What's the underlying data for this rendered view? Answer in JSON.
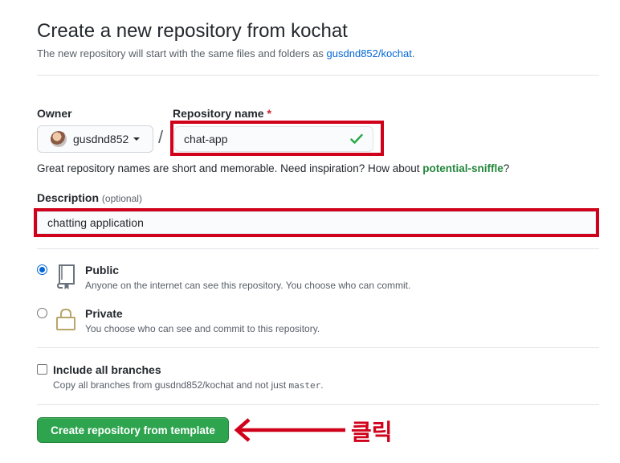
{
  "header": {
    "title": "Create a new repository from kochat",
    "subtitle_prefix": "The new repository will start with the same files and folders as ",
    "subtitle_link": "gusdnd852/kochat",
    "subtitle_suffix": "."
  },
  "form": {
    "owner_label": "Owner",
    "owner_value": "gusdnd852",
    "repo_name_label": "Repository name",
    "required_mark": "*",
    "repo_name_value": "chat-app",
    "separator": "/",
    "hint_prefix": "Great repository names are short and memorable. Need inspiration? How about ",
    "hint_suggestion": "potential-sniffle",
    "hint_suffix": "?",
    "description_label": "Description",
    "description_optional": "(optional)",
    "description_value": "chatting application"
  },
  "visibility": {
    "public_title": "Public",
    "public_desc": "Anyone on the internet can see this repository. You choose who can commit.",
    "private_title": "Private",
    "private_desc": "You choose who can see and commit to this repository.",
    "selected": "public"
  },
  "branches": {
    "title": "Include all branches",
    "desc_prefix": "Copy all branches from gusdnd852/kochat and not just ",
    "desc_branch": "master",
    "desc_suffix": "."
  },
  "actions": {
    "create_label": "Create repository from template"
  },
  "annotation": {
    "text": "클릭",
    "color": "#d0021b"
  },
  "colors": {
    "primary_button": "#2ea44f",
    "link": "#0366d6",
    "suggestion": "#22863a",
    "highlight_box": "#d0021b"
  },
  "icons": {
    "valid": "check-icon",
    "public": "repo-icon",
    "private": "lock-icon",
    "owner_menu": "caret-down-icon",
    "annotation_pointer": "arrow-left-icon"
  }
}
